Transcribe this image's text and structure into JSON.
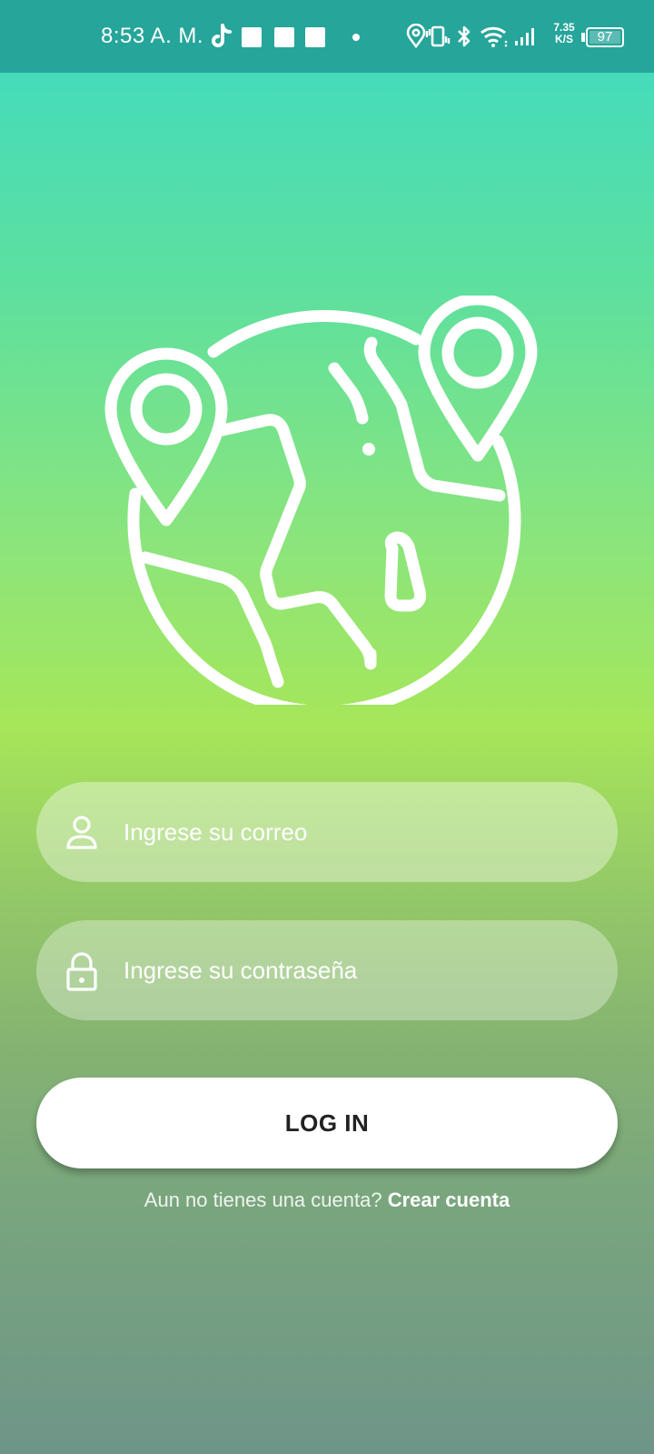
{
  "status_bar": {
    "time": "8:53 A. M.",
    "network_speed_value": "7.35",
    "network_speed_unit": "K/S",
    "battery_level": "97"
  },
  "login_form": {
    "email_placeholder": "Ingrese su correo",
    "password_placeholder": "Ingrese su contraseña",
    "login_label": "LOG IN"
  },
  "signup": {
    "prompt": "Aun no tienes una cuenta?",
    "link_label": "Crear cuenta"
  },
  "icons": {
    "logo": "globe-with-location-pins-icon",
    "email_field": "user-icon",
    "password_field": "lock-icon"
  },
  "colors": {
    "status_bar_bg": "#26a59a",
    "gradient_top": "#3ddac4",
    "gradient_mid": "#a6e659",
    "gradient_bottom": "#6e9588",
    "button_bg": "#ffffff",
    "button_text": "#222222"
  }
}
